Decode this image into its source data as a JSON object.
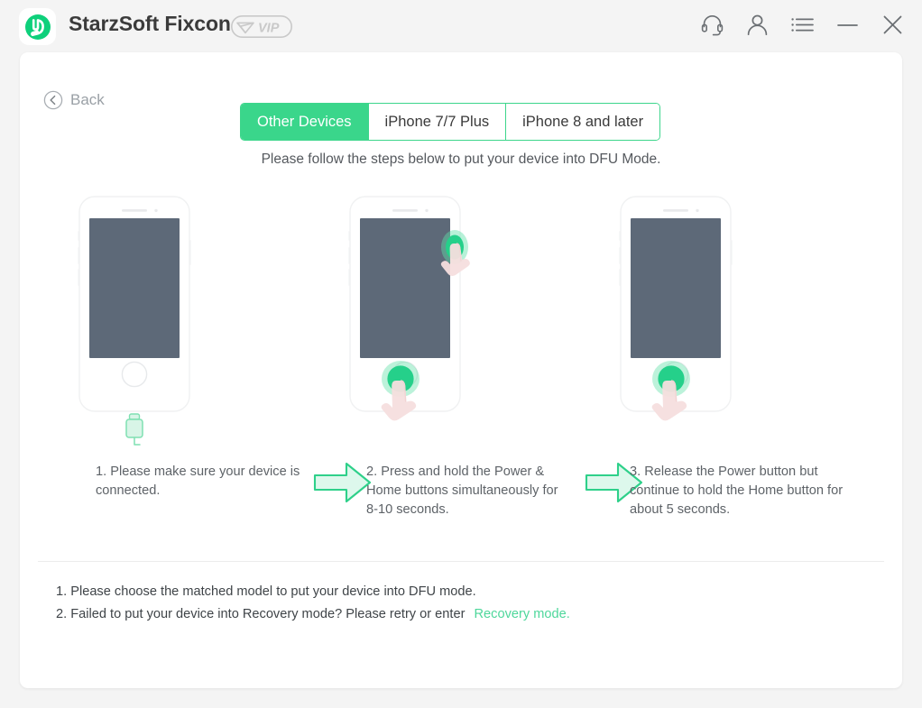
{
  "window": {
    "background": "#f4f4f4",
    "accent": "#3ad68b",
    "app_title": "StarzSoft Fixcon",
    "logo_icon": "wrench-circle-logo",
    "badge": {
      "label": "VIP",
      "icon": "diamond-icon",
      "color": "#c9c9c9"
    },
    "controls": [
      {
        "name": "headset-icon",
        "label": "Support"
      },
      {
        "name": "user-icon",
        "label": "Account"
      },
      {
        "name": "menu-icon",
        "label": "Menu"
      },
      {
        "name": "minimize-icon",
        "label": "Minimize"
      },
      {
        "name": "close-icon",
        "label": "Close"
      }
    ]
  },
  "nav": {
    "back_label": "Back",
    "back_icon": "chevron-left-circle-icon"
  },
  "tabs": [
    {
      "label": "Other Devices",
      "active": true
    },
    {
      "label": "iPhone 7/7 Plus",
      "active": false
    },
    {
      "label": "iPhone 8 and later",
      "active": false
    }
  ],
  "main": {
    "subtitle": "Please follow the steps below to put your device into DFU Mode.",
    "steps": [
      {
        "id": "step-1",
        "caption": "1. Please make sure your device is connected.",
        "phone_icon": "iphone-with-cable-icon",
        "indicators": []
      },
      {
        "id": "step-2",
        "caption": "2. Press and hold the Power & Home buttons simultaneously for 8-10 seconds.",
        "phone_icon": "iphone-icon",
        "indicators": [
          "power-button-press",
          "home-button-press"
        ]
      },
      {
        "id": "step-3",
        "caption": "3. Release the Power button but continue to hold the Home button for about 5 seconds.",
        "phone_icon": "iphone-icon",
        "indicators": [
          "home-button-press"
        ]
      }
    ],
    "arrows": [
      {
        "name": "arrow-right-1"
      },
      {
        "name": "arrow-right-2"
      }
    ]
  },
  "footer": {
    "note_1": "1. Please choose the matched model to put your device into DFU mode.",
    "note_2": "2. Failed to put your device into Recovery mode? Please retry or enter",
    "recovery_link": "Recovery mode."
  }
}
